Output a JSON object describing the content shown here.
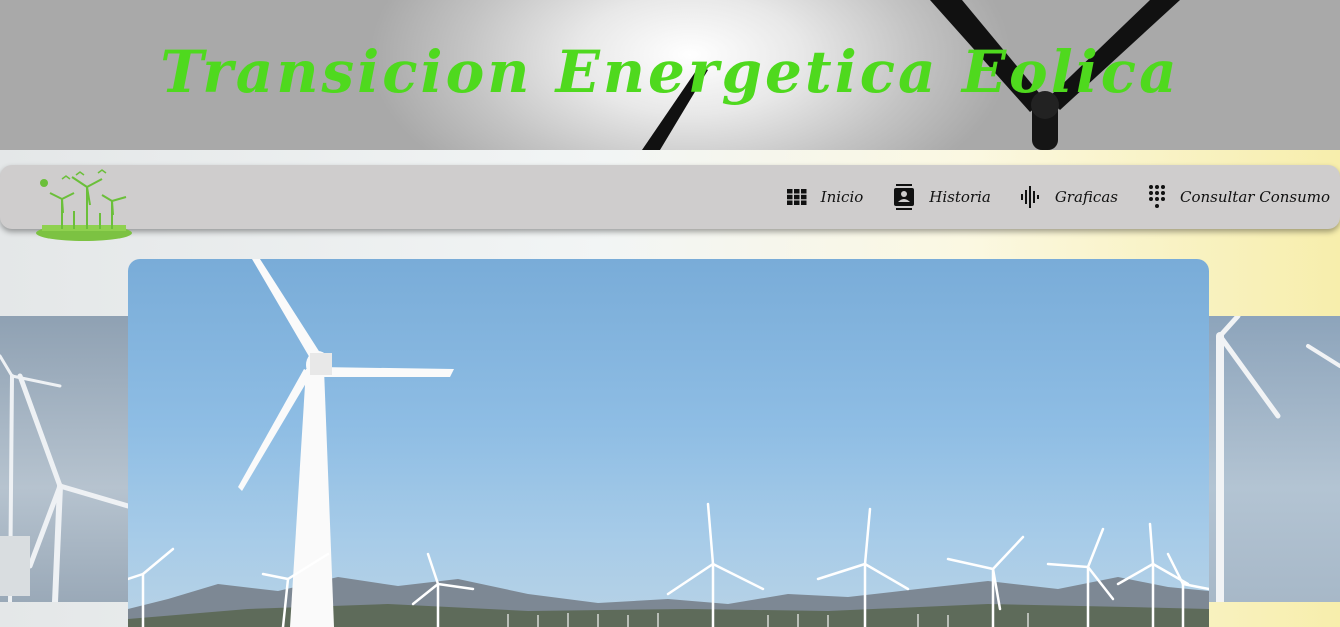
{
  "header": {
    "title": "Transicion Energetica Eolica"
  },
  "navbar": {
    "logo_icon": "wind-turbines-logo",
    "items": [
      {
        "label": "Inicio",
        "icon": "grid-icon"
      },
      {
        "label": "Historia",
        "icon": "contact-book-icon"
      },
      {
        "label": "Graficas",
        "icon": "sound-wave-icon"
      },
      {
        "label": "Consultar Consumo",
        "icon": "dialpad-icon"
      }
    ]
  },
  "carousel": {
    "image": "wind-farm-photo"
  },
  "colors": {
    "title_green": "#4fd91e",
    "navbar_bg": "#cfcdcd",
    "sky_blue": "#8ebde4"
  }
}
